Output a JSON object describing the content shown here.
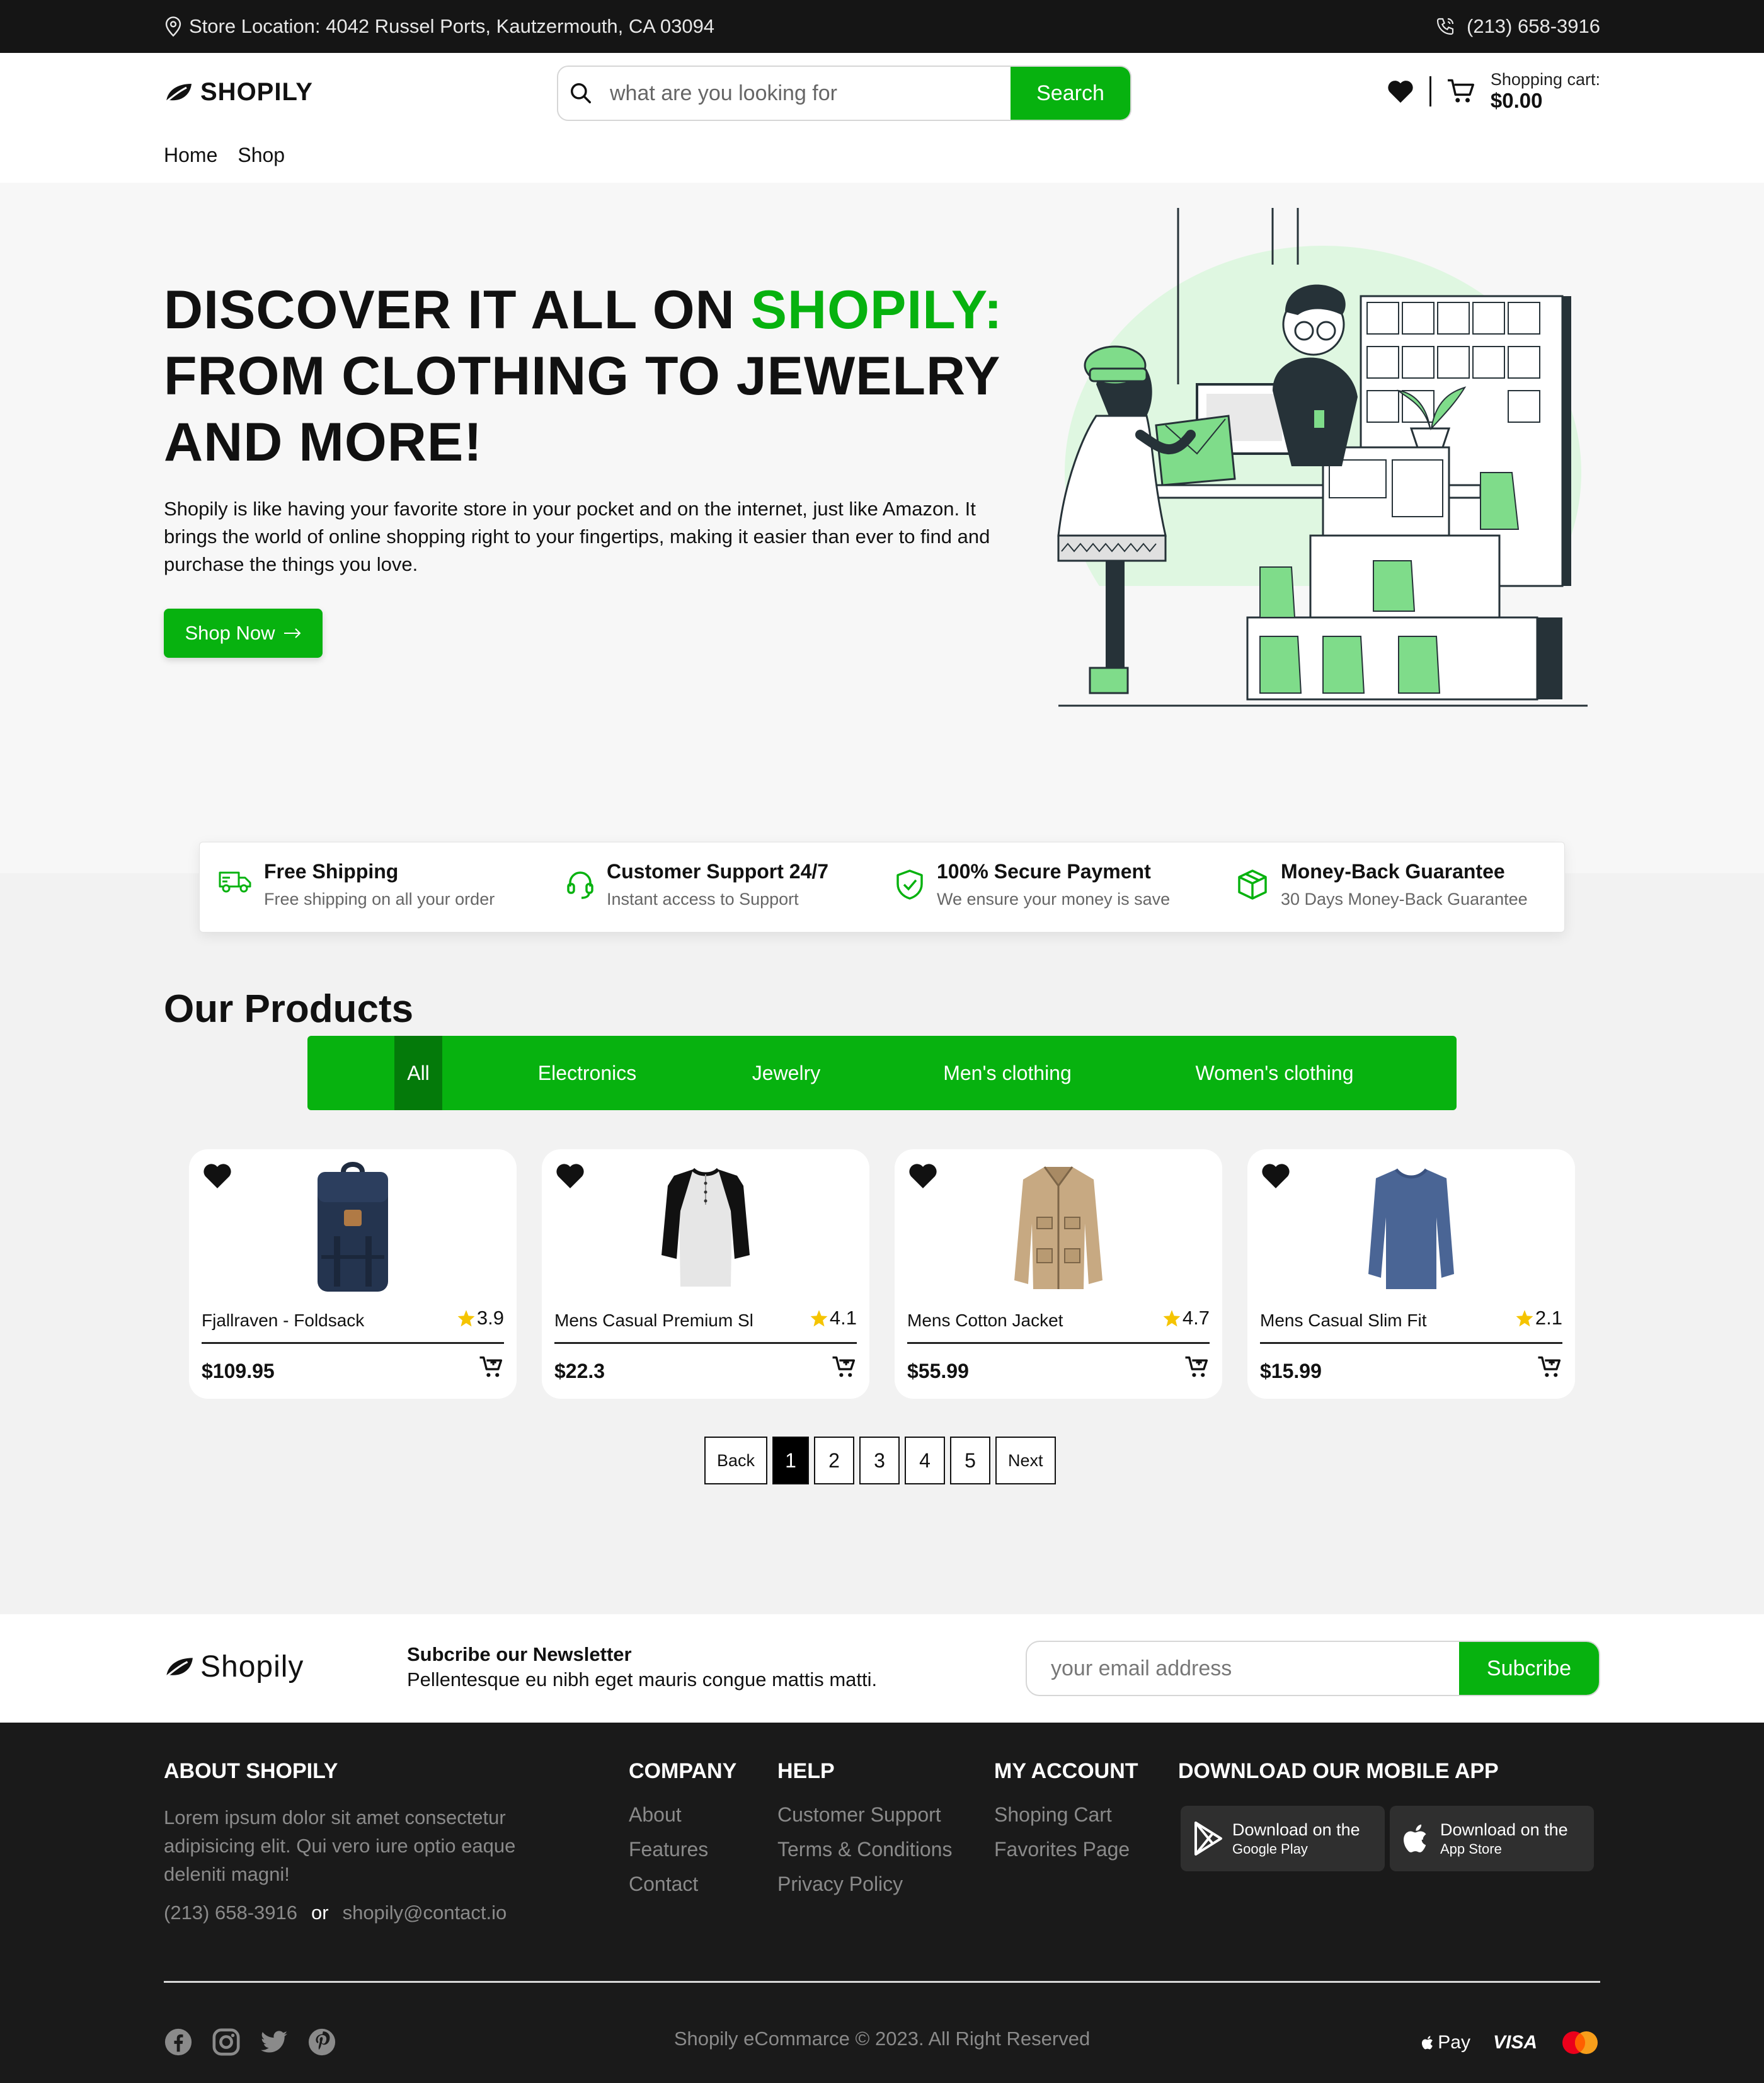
{
  "topbar": {
    "location": "Store Location: 4042 Russel Ports, Kautzermouth, CA 03094",
    "phone": "(213) 658-3916"
  },
  "header": {
    "logo": "SHOPILY",
    "search_placeholder": "what are you looking for",
    "search_button": "Search",
    "cart_label": "Shopping cart:",
    "cart_total": "$0.00"
  },
  "nav": [
    "Home",
    "Shop"
  ],
  "hero": {
    "title_part1": "DISCOVER IT ALL ON ",
    "title_highlight": "SHOPILY:",
    "title_part2": "FROM CLOTHING TO JEWELRY AND MORE!",
    "description": "Shopily is like having your favorite store in your pocket and on the internet, just like Amazon. It brings the world of online shopping right to your fingertips, making it easier than ever to find and purchase the things you love.",
    "cta": "Shop Now"
  },
  "features": [
    {
      "title": "Free Shipping",
      "subtitle": "Free shipping on all your order",
      "icon": "truck-icon"
    },
    {
      "title": "Customer Support 24/7",
      "subtitle": "Instant access to Support",
      "icon": "headset-icon"
    },
    {
      "title": "100% Secure Payment",
      "subtitle": "We ensure your money is save",
      "icon": "shield-check-icon"
    },
    {
      "title": "Money-Back Guarantee",
      "subtitle": "30 Days Money-Back Guarantee",
      "icon": "box-icon"
    }
  ],
  "products_section": {
    "title": "Our Products",
    "categories": [
      "All",
      "Electronics",
      "Jewelry",
      "Men's clothing",
      "Women's clothing"
    ],
    "active_category": "All",
    "items": [
      {
        "name": "Fjallraven - Foldsack",
        "rating": "3.9",
        "price": "$109.95",
        "image": "backpack"
      },
      {
        "name": "Mens Casual Premium Sl",
        "rating": "4.1",
        "price": "$22.3",
        "image": "raglan-shirt"
      },
      {
        "name": "Mens Cotton Jacket",
        "rating": "4.7",
        "price": "$55.99",
        "image": "jacket"
      },
      {
        "name": "Mens Casual Slim Fit",
        "rating": "2.1",
        "price": "$15.99",
        "image": "long-sleeve-shirt"
      }
    ]
  },
  "pagination": {
    "back": "Back",
    "pages": [
      "1",
      "2",
      "3",
      "4",
      "5"
    ],
    "current": "1",
    "next": "Next"
  },
  "newsletter": {
    "logo": "Shopily",
    "title": "Subcribe our Newsletter",
    "text": "Pellentesque eu nibh eget mauris congue mattis matti.",
    "placeholder": "your email address",
    "button": "Subcribe"
  },
  "footer": {
    "about_heading": "ABOUT SHOPILY",
    "about_text": "Lorem ipsum dolor sit amet consectetur adipisicing elit. Qui vero iure optio eaque deleniti magni!",
    "phone": "(213) 658-3916",
    "or": "or",
    "email": "shopily@contact.io",
    "company_heading": "COMPANY",
    "company_links": [
      "About",
      "Features",
      "Contact"
    ],
    "help_heading": "HELP",
    "help_links": [
      "Customer Support",
      "Terms & Conditions",
      "Privacy Policy"
    ],
    "account_heading": "MY ACCOUNT",
    "account_links": [
      "Shoping Cart",
      "Favorites Page"
    ],
    "app_heading": "DOWNLOAD OUR MOBILE APP",
    "google_play": {
      "line1": "Download on the",
      "line2": "Google Play"
    },
    "app_store": {
      "line1": "Download on the",
      "line2": "App Store"
    },
    "copyright": "Shopily eCommarce © 2023. All Right Reserved",
    "payments": {
      "applepay": "Pay",
      "visa": "VISA"
    }
  },
  "colors": {
    "accent": "#07b20f",
    "accent_dark": "#047a0a",
    "dark": "#151515",
    "footer": "#1a1a1a"
  }
}
